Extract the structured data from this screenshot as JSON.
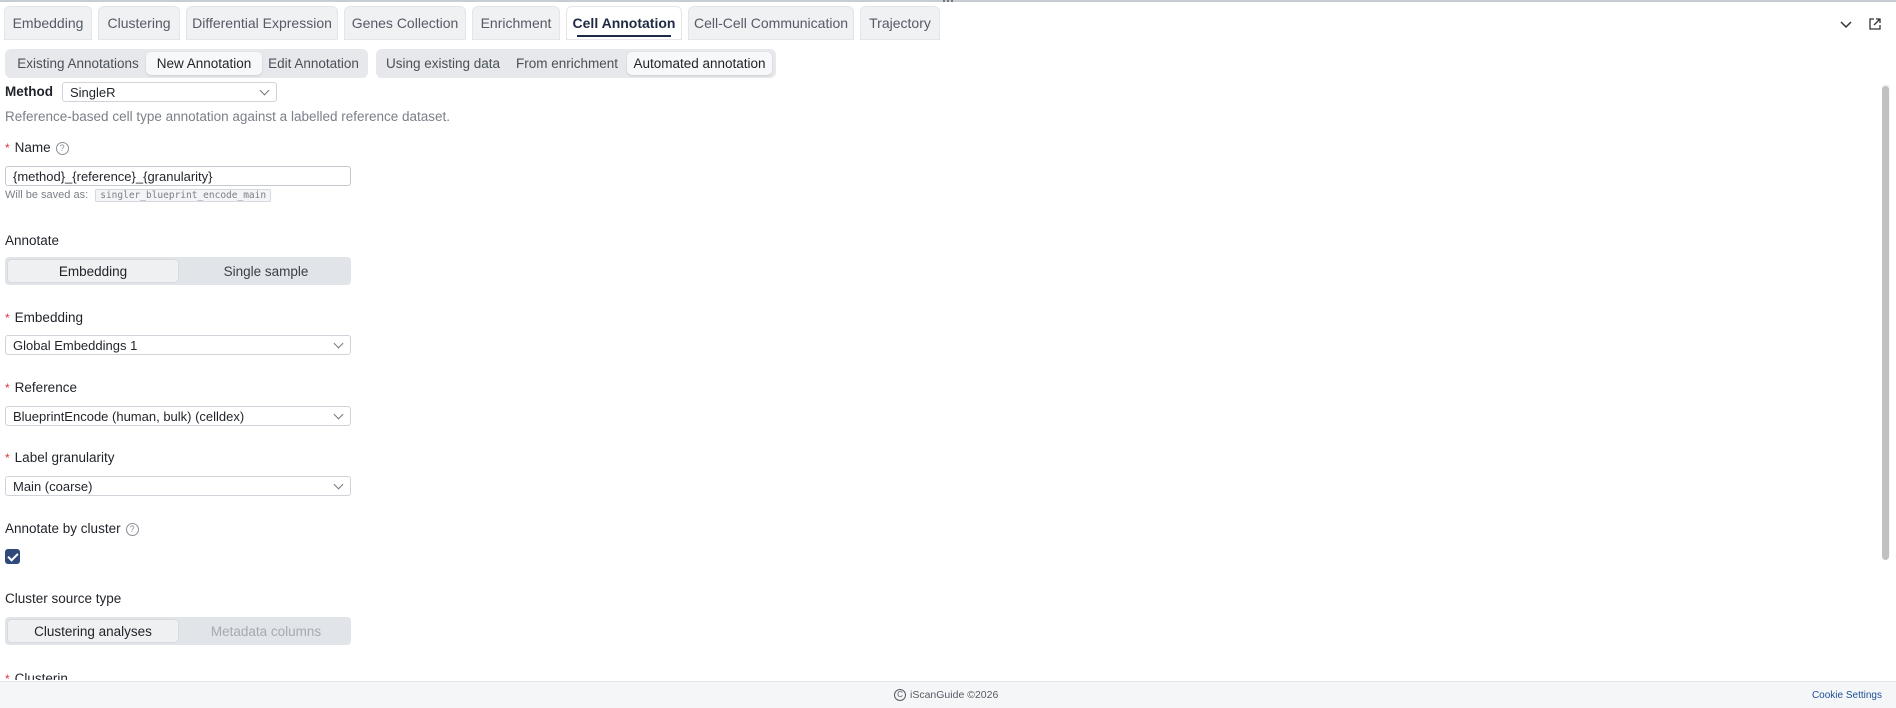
{
  "main_tabs": [
    {
      "label": "Embedding",
      "active": false
    },
    {
      "label": "Clustering",
      "active": false
    },
    {
      "label": "Differential Expression",
      "active": false
    },
    {
      "label": "Genes Collection",
      "active": false
    },
    {
      "label": "Enrichment",
      "active": false
    },
    {
      "label": "Cell Annotation",
      "active": true
    },
    {
      "label": "Cell-Cell Communication",
      "active": false
    },
    {
      "label": "Trajectory",
      "active": false
    }
  ],
  "tab_icons": {
    "collapse": "chevron-down-icon",
    "popout": "external-link-icon"
  },
  "annotation_modes": [
    {
      "label": "Existing Annotations",
      "active": false
    },
    {
      "label": "New Annotation",
      "active": true
    },
    {
      "label": "Edit Annotation",
      "active": false
    }
  ],
  "source_modes": [
    {
      "label": "Using existing data",
      "active": false
    },
    {
      "label": "From enrichment",
      "active": false
    },
    {
      "label": "Automated annotation",
      "active": true
    }
  ],
  "method": {
    "label": "Method",
    "value": "SingleR",
    "description": "Reference-based cell type annotation against a labelled reference dataset."
  },
  "name_field": {
    "label": "Name",
    "value": "{method}_{reference}_{granularity}",
    "saved_as_label": "Will be saved as:",
    "saved_as_value": "singler_blueprint_encode_main"
  },
  "annotate": {
    "label": "Annotate",
    "options": [
      "Embedding",
      "Single sample"
    ],
    "selected": "Embedding"
  },
  "embedding": {
    "label": "Embedding",
    "value": "Global Embeddings 1"
  },
  "reference": {
    "label": "Reference",
    "value": "BlueprintEncode (human, bulk) (celldex)"
  },
  "granularity": {
    "label": "Label granularity",
    "value": "Main (coarse)"
  },
  "annotate_by_cluster": {
    "label": "Annotate by cluster",
    "checked": true
  },
  "cluster_source": {
    "label": "Cluster source type",
    "options": [
      "Clustering analyses",
      "Metadata columns"
    ],
    "selected": "Clustering analyses"
  },
  "clusters_label_partial": "Clusterin",
  "footer": {
    "brand": "iScanGuide ©2026",
    "cookie": "Cookie Settings"
  },
  "colors": {
    "accent": "#2f4a7a",
    "required": "#d9363e",
    "link": "#1f4f9a"
  }
}
